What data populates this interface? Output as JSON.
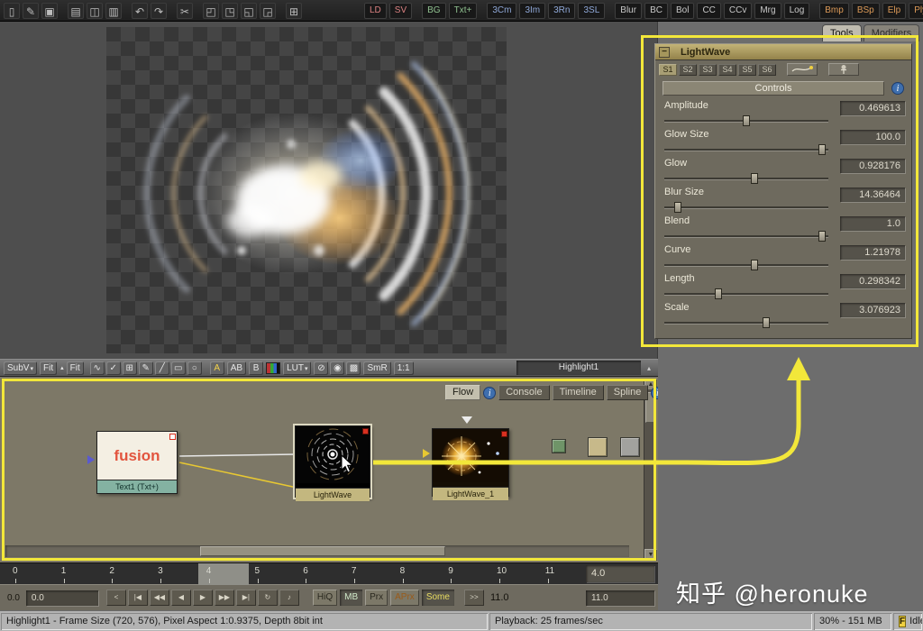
{
  "watermark": "知乎 @heronuke",
  "colors": {
    "annotation_yellow": "#f2e73a",
    "info_blue": "#3f6fae"
  },
  "top_toolbar": {
    "file_icons": [
      {
        "name": "new-icon",
        "glyph": "▯"
      },
      {
        "name": "edit-icon",
        "glyph": "✎"
      },
      {
        "name": "save-icon",
        "glyph": "▣"
      },
      {
        "name": "import-icon",
        "glyph": "▤"
      },
      {
        "name": "copy-icon",
        "glyph": "◫"
      },
      {
        "name": "paste-icon",
        "glyph": "▥"
      },
      {
        "name": "undo-icon",
        "glyph": "↶"
      },
      {
        "name": "redo-icon",
        "glyph": "↷"
      },
      {
        "name": "scissors-icon",
        "glyph": "✂"
      },
      {
        "name": "layout-left-icon",
        "glyph": "◰"
      },
      {
        "name": "layout-right-icon",
        "glyph": "◳"
      },
      {
        "name": "layout-split-icon",
        "glyph": "◱"
      },
      {
        "name": "layout-quad-icon",
        "glyph": "◲"
      },
      {
        "name": "grid-icon",
        "glyph": "⊞"
      }
    ],
    "tool_buttons": [
      {
        "label": "LD",
        "color": "#d98080",
        "group": 0
      },
      {
        "label": "SV",
        "color": "#d98080",
        "group": 0
      },
      {
        "label": "BG",
        "color": "#8fc08f",
        "group": 1
      },
      {
        "label": "Txt+",
        "color": "#8fc08f",
        "group": 0
      },
      {
        "label": "3Cm",
        "color": "#8fa8d8",
        "group": 1
      },
      {
        "label": "3Im",
        "color": "#8fa8d8",
        "group": 0
      },
      {
        "label": "3Rn",
        "color": "#8fa8d8",
        "group": 0
      },
      {
        "label": "3SL",
        "color": "#8fa8d8",
        "group": 0
      },
      {
        "label": "Blur",
        "color": "#c8c8c8",
        "group": 1
      },
      {
        "label": "BC",
        "color": "#c8c8c8",
        "group": 0
      },
      {
        "label": "Bol",
        "color": "#c8c8c8",
        "group": 0
      },
      {
        "label": "CC",
        "color": "#c8c8c8",
        "group": 0
      },
      {
        "label": "CCv",
        "color": "#c8c8c8",
        "group": 0
      },
      {
        "label": "Mrg",
        "color": "#c8c8c8",
        "group": 0
      },
      {
        "label": "Log",
        "color": "#c8c8c8",
        "group": 0
      },
      {
        "label": "Bmp",
        "color": "#dc9a58",
        "group": 1
      },
      {
        "label": "BSp",
        "color": "#dc9a58",
        "group": 0
      },
      {
        "label": "Elp",
        "color": "#dc9a58",
        "group": 0
      },
      {
        "label": "Ply",
        "color": "#dc9a58",
        "group": 0
      }
    ]
  },
  "right_panel": {
    "tabs": [
      {
        "label": "Tools",
        "active": true
      },
      {
        "label": "Modifiers",
        "active": false
      }
    ],
    "lightwave": {
      "title": "LightWave",
      "collapse": "−",
      "s_tabs": [
        {
          "label": "S1",
          "active": true
        },
        {
          "label": "S2",
          "active": false
        },
        {
          "label": "S3",
          "active": false
        },
        {
          "label": "S4",
          "active": false
        },
        {
          "label": "S5",
          "active": false
        },
        {
          "label": "S6",
          "active": false
        }
      ],
      "controls_label": "Controls",
      "info": "i",
      "sliders": [
        {
          "label": "Amplitude",
          "value": "0.469613",
          "pos": 0.5
        },
        {
          "label": "Glow Size",
          "value": "100.0",
          "pos": 0.96
        },
        {
          "label": "Glow",
          "value": "0.928176",
          "pos": 0.55
        },
        {
          "label": "Blur Size",
          "value": "14.36464",
          "pos": 0.08
        },
        {
          "label": "Blend",
          "value": "1.0",
          "pos": 0.96
        },
        {
          "label": "Curve",
          "value": "1.21978",
          "pos": 0.55
        },
        {
          "label": "Length",
          "value": "0.298342",
          "pos": 0.33
        },
        {
          "label": "Scale",
          "value": "3.076923",
          "pos": 0.62
        }
      ]
    }
  },
  "viewport_toolbar": {
    "subv": "SubV",
    "fit_left": "Fit",
    "fit_right": "Fit",
    "icons": [
      {
        "name": "wave-icon",
        "glyph": "∿"
      },
      {
        "name": "select-icon",
        "glyph": "✓"
      },
      {
        "name": "grid-icon",
        "glyph": "⊞"
      },
      {
        "name": "pencil-icon",
        "glyph": "✎"
      },
      {
        "name": "line-icon",
        "glyph": "╱"
      },
      {
        "name": "rectangle-icon",
        "glyph": "▭"
      },
      {
        "name": "ellipse-icon",
        "glyph": "○"
      }
    ],
    "channel_a": "A",
    "channel_ab": "AB",
    "channel_b": "B",
    "lut": "LUT",
    "right_icons": [
      {
        "name": "lock-icon",
        "glyph": "⊘"
      },
      {
        "name": "alpha-overlay-icon",
        "glyph": "◉"
      },
      {
        "name": "checker-underlay-icon",
        "glyph": "▩"
      }
    ],
    "smr": "SmR",
    "ratio": "1:1",
    "view_name": "Highlight1"
  },
  "flow": {
    "tabs": [
      {
        "label": "Flow",
        "active": true
      },
      {
        "label": "Console",
        "active": false
      },
      {
        "label": "Timeline",
        "active": false
      },
      {
        "label": "Spline",
        "active": false
      }
    ],
    "info": "i",
    "nodes": {
      "text1": {
        "body": "fusion",
        "label": "Text1 (Txt+)"
      },
      "lightwave": {
        "label": "LightWave"
      },
      "lightwave_1": {
        "label": "LightWave_1"
      }
    }
  },
  "timeline": {
    "ticks": [
      "0",
      "1",
      "2",
      "3",
      "4",
      "5",
      "6",
      "7",
      "8",
      "9",
      "10",
      "11"
    ],
    "current_value": "4.0"
  },
  "transport": {
    "left_value": "0.0",
    "current_frame": "0.0",
    "buttons": [
      {
        "name": "jump-back-icon",
        "glyph": "<"
      },
      {
        "name": "goto-start-icon",
        "glyph": "|◀"
      },
      {
        "name": "fast-reverse-icon",
        "glyph": "◀◀"
      },
      {
        "name": "play-reverse-icon",
        "glyph": "◀"
      },
      {
        "name": "play-icon",
        "glyph": "▶"
      },
      {
        "name": "fast-forward-icon",
        "glyph": "▶▶"
      },
      {
        "name": "goto-end-icon",
        "glyph": "▶|"
      },
      {
        "name": "loop-icon",
        "glyph": "↻"
      },
      {
        "name": "audio-icon",
        "glyph": "♪"
      }
    ],
    "quality": [
      {
        "label": "HiQ",
        "active": false,
        "color": "#2a281f"
      },
      {
        "label": "MB",
        "active": true,
        "color": "#cfe8c8"
      },
      {
        "label": "Prx",
        "active": false,
        "color": "#2a281f"
      },
      {
        "label": "APrx",
        "active": false,
        "color": "#9a5a18"
      },
      {
        "label": "Some",
        "active": true,
        "color": "#e8dc60"
      }
    ],
    "step_label": ">>",
    "end_frame": "11.0",
    "end_value": "11.0"
  },
  "status_bar": {
    "info": "Highlight1 - Frame Size (720, 576), Pixel Aspect 1:0.9375, Depth 8bit int",
    "playback": "Playback: 25 frames/sec",
    "memory": "30% - 151 MB",
    "app_badge": "F",
    "state": "Idle"
  }
}
